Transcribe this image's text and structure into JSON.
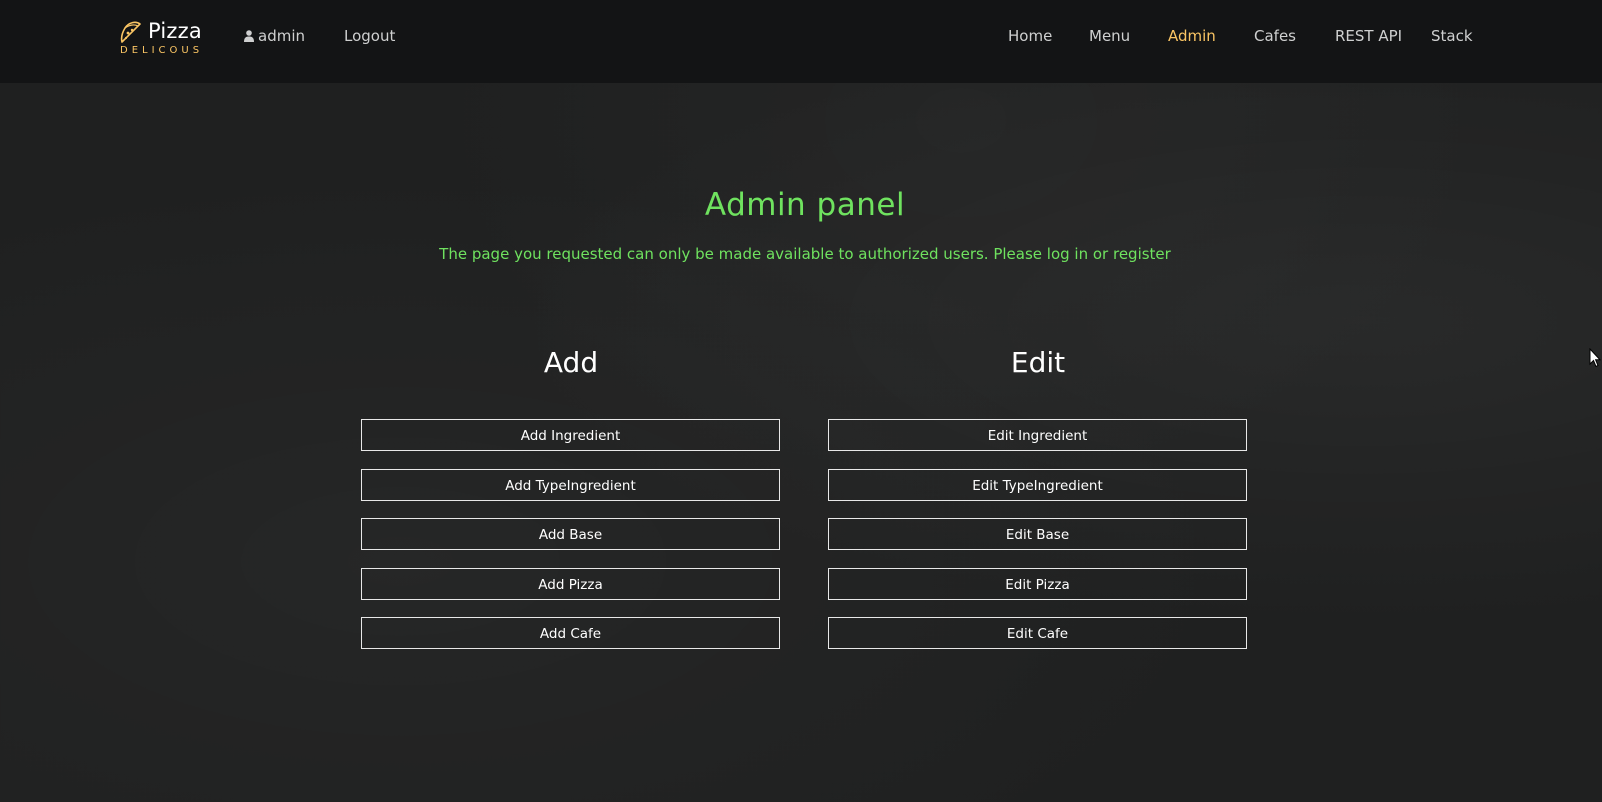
{
  "brand": {
    "name": "Pizza",
    "subtitle": "DELICOUS"
  },
  "nav_left": {
    "user_label": "admin",
    "logout_label": "Logout"
  },
  "nav_right": {
    "items": [
      {
        "label": "Home"
      },
      {
        "label": "Menu"
      },
      {
        "label": "Admin",
        "active": true
      },
      {
        "label": "Cafes"
      },
      {
        "label": "REST API"
      },
      {
        "label": "Stack"
      }
    ]
  },
  "main": {
    "title": "Admin panel",
    "message": "The page you requested can only be made available to authorized users. Please log in or register",
    "add": {
      "heading": "Add",
      "buttons": [
        "Add Ingredient",
        "Add TypeIngredient",
        "Add Base",
        "Add Pizza",
        "Add Cafe"
      ]
    },
    "edit": {
      "heading": "Edit",
      "buttons": [
        "Edit Ingredient",
        "Edit TypeIngredient",
        "Edit Base",
        "Edit Pizza",
        "Edit Cafe"
      ]
    }
  },
  "colors": {
    "accent": "#fac564",
    "success_text": "#6fe25f",
    "header_bg": "#131415",
    "page_bg": "#1f2020"
  },
  "icons": {
    "brand": "pizza-slice-icon",
    "user": "user-icon",
    "cursor": "mouse-pointer-icon"
  }
}
